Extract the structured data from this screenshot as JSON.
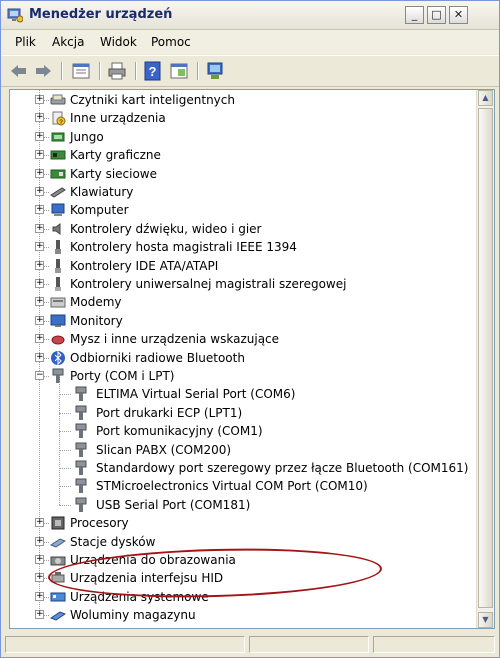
{
  "window": {
    "title": "Menedżer urządzeń",
    "min_glyph": "_",
    "max_glyph": "□",
    "close_glyph": "✕"
  },
  "menu": [
    "Plik",
    "Akcja",
    "Widok",
    "Pomoc"
  ],
  "toolbar": [
    "back-icon",
    "forward-icon",
    "properties-icon",
    "print-icon",
    "help-icon",
    "view-icon",
    "scan-hardware-icon"
  ],
  "tree": {
    "categories": [
      {
        "label": "Czytniki kart inteligentnych",
        "icon": "smart-card-reader-icon",
        "expanded": false
      },
      {
        "label": "Inne urządzenia",
        "icon": "unknown-device-icon",
        "expanded": false
      },
      {
        "label": "Jungo",
        "icon": "jungo-icon",
        "expanded": false
      },
      {
        "label": "Karty graficzne",
        "icon": "display-adapter-icon",
        "expanded": false
      },
      {
        "label": "Karty sieciowe",
        "icon": "network-adapter-icon",
        "expanded": false
      },
      {
        "label": "Klawiatury",
        "icon": "keyboard-icon",
        "expanded": false
      },
      {
        "label": "Komputer",
        "icon": "computer-icon",
        "expanded": false
      },
      {
        "label": "Kontrolery dźwięku, wideo i gier",
        "icon": "sound-controller-icon",
        "expanded": false
      },
      {
        "label": "Kontrolery hosta magistrali IEEE 1394",
        "icon": "ieee1394-icon",
        "expanded": false
      },
      {
        "label": "Kontrolery IDE ATA/ATAPI",
        "icon": "ide-controller-icon",
        "expanded": false
      },
      {
        "label": "Kontrolery uniwersalnej magistrali szeregowej",
        "icon": "usb-controller-icon",
        "expanded": false
      },
      {
        "label": "Modemy",
        "icon": "modem-icon",
        "expanded": false
      },
      {
        "label": "Monitory",
        "icon": "monitor-icon",
        "expanded": false
      },
      {
        "label": "Mysz i inne urządzenia wskazujące",
        "icon": "mouse-icon",
        "expanded": false
      },
      {
        "label": "Odbiorniki radiowe Bluetooth",
        "icon": "bluetooth-icon",
        "expanded": false
      },
      {
        "label": "Porty (COM i LPT)",
        "icon": "port-icon",
        "expanded": true,
        "children": [
          "ELTIMA Virtual Serial Port (COM6)",
          "Port drukarki ECP (LPT1)",
          "Port komunikacyjny (COM1)",
          "Slican PABX (COM200)",
          "Standardowy port szeregowy przez łącze Bluetooth (COM161)",
          "STMicroelectronics Virtual COM Port (COM10)",
          "USB Serial Port (COM181)"
        ]
      },
      {
        "label": "Procesory",
        "icon": "processor-icon",
        "expanded": false
      },
      {
        "label": "Stacje dysków",
        "icon": "disk-drive-icon",
        "expanded": false
      },
      {
        "label": "Urządzenia do obrazowania",
        "icon": "imaging-device-icon",
        "expanded": false
      },
      {
        "label": "Urządzenia interfejsu HID",
        "icon": "hid-icon",
        "expanded": false
      },
      {
        "label": "Urządzenia systemowe",
        "icon": "system-device-icon",
        "expanded": false
      },
      {
        "label": "Woluminy magazynu",
        "icon": "storage-volume-icon",
        "expanded": false
      }
    ]
  },
  "colors": {
    "highlight_ellipse": "#a41416",
    "title_text": "#1a2a6a"
  }
}
